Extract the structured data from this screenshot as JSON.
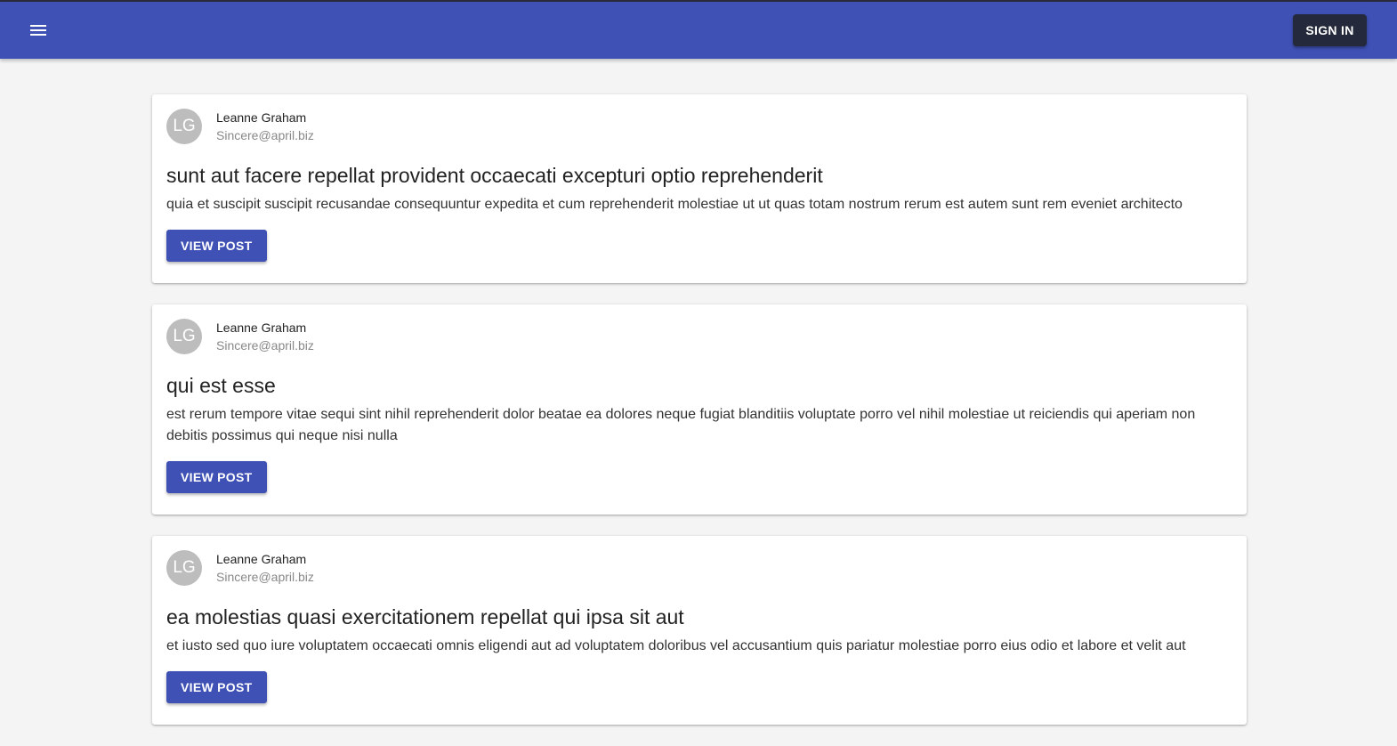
{
  "appbar": {
    "menu_icon": "menu-icon",
    "sign_in_label": "SIGN IN",
    "color": "#3f51b5"
  },
  "posts": [
    {
      "avatar_initials": "LG",
      "author_name": "Leanne Graham",
      "author_email": "Sincere@april.biz",
      "title": "sunt aut facere repellat provident occaecati excepturi optio reprehenderit",
      "body": "quia et suscipit suscipit recusandae consequuntur expedita et cum reprehenderit molestiae ut ut quas totam nostrum rerum est autem sunt rem eveniet architecto",
      "button_label": "VIEW POST"
    },
    {
      "avatar_initials": "LG",
      "author_name": "Leanne Graham",
      "author_email": "Sincere@april.biz",
      "title": "qui est esse",
      "body": "est rerum tempore vitae sequi sint nihil reprehenderit dolor beatae ea dolores neque fugiat blanditiis voluptate porro vel nihil molestiae ut reiciendis qui aperiam non debitis possimus qui neque nisi nulla",
      "button_label": "VIEW POST"
    },
    {
      "avatar_initials": "LG",
      "author_name": "Leanne Graham",
      "author_email": "Sincere@april.biz",
      "title": "ea molestias quasi exercitationem repellat qui ipsa sit aut",
      "body": "et iusto sed quo iure voluptatem occaecati omnis eligendi aut ad voluptatem doloribus vel accusantium quis pariatur molestiae porro eius odio et labore et velit aut",
      "button_label": "VIEW POST"
    }
  ]
}
